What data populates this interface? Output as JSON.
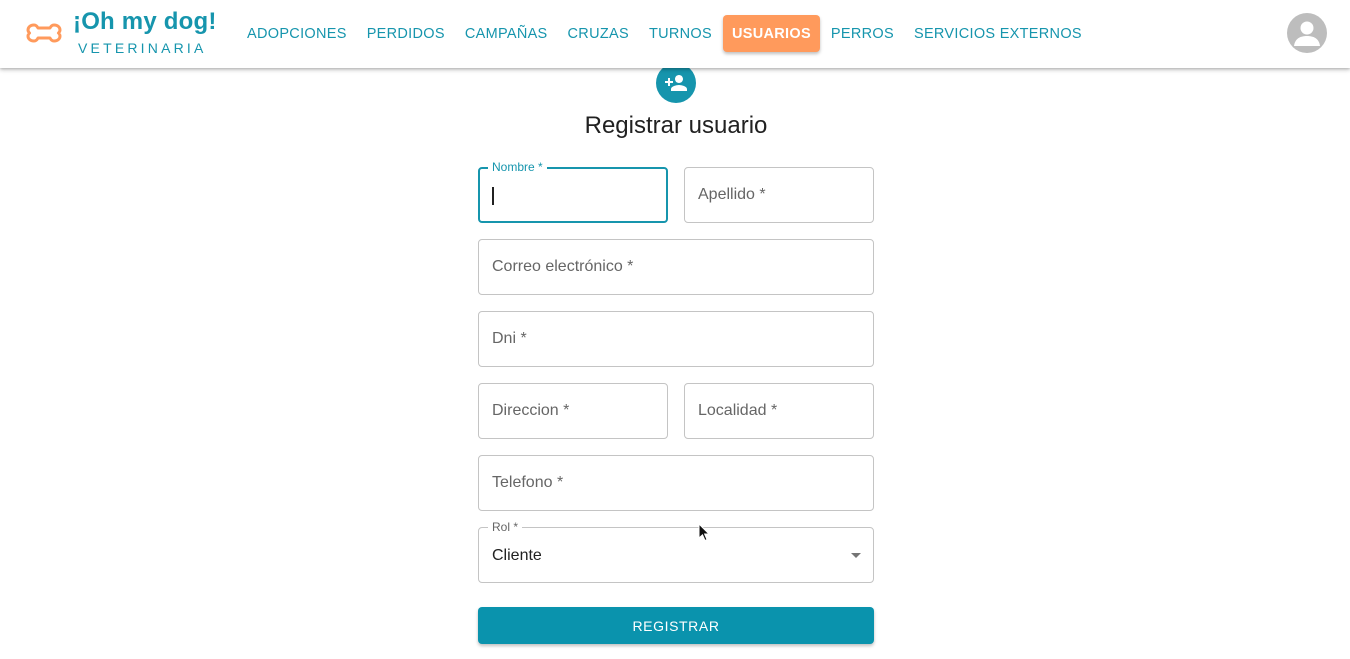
{
  "brand": {
    "title": "¡Oh my dog!",
    "subtitle": "VETERINARIA",
    "logo_icon": "bone-icon",
    "color": "#1695ad",
    "logo_color": "#ff9a5c"
  },
  "nav": {
    "items": [
      {
        "label": "ADOPCIONES",
        "active": false
      },
      {
        "label": "PERDIDOS",
        "active": false
      },
      {
        "label": "CAMPAÑAS",
        "active": false
      },
      {
        "label": "CRUZAS",
        "active": false
      },
      {
        "label": "TURNOS",
        "active": false
      },
      {
        "label": "USUARIOS",
        "active": true
      },
      {
        "label": "PERROS",
        "active": false
      },
      {
        "label": "SERVICIOS EXTERNOS",
        "active": false
      }
    ],
    "active_color": "#ff9a5c"
  },
  "account": {
    "icon": "account-circle-icon"
  },
  "form": {
    "icon": "person-add-icon",
    "title": "Registrar usuario",
    "fields": {
      "nombre": {
        "label": "Nombre *",
        "value": ""
      },
      "apellido": {
        "label": "Apellido *",
        "value": ""
      },
      "correo": {
        "label": "Correo electrónico *",
        "value": ""
      },
      "dni": {
        "label": "Dni *",
        "value": ""
      },
      "direccion": {
        "label": "Direccion *",
        "value": ""
      },
      "localidad": {
        "label": "Localidad *",
        "value": ""
      },
      "telefono": {
        "label": "Telefono *",
        "value": ""
      },
      "rol": {
        "label": "Rol *",
        "value": "Cliente"
      }
    },
    "submit_label": "REGISTRAR",
    "accent_color": "#1695ad"
  }
}
